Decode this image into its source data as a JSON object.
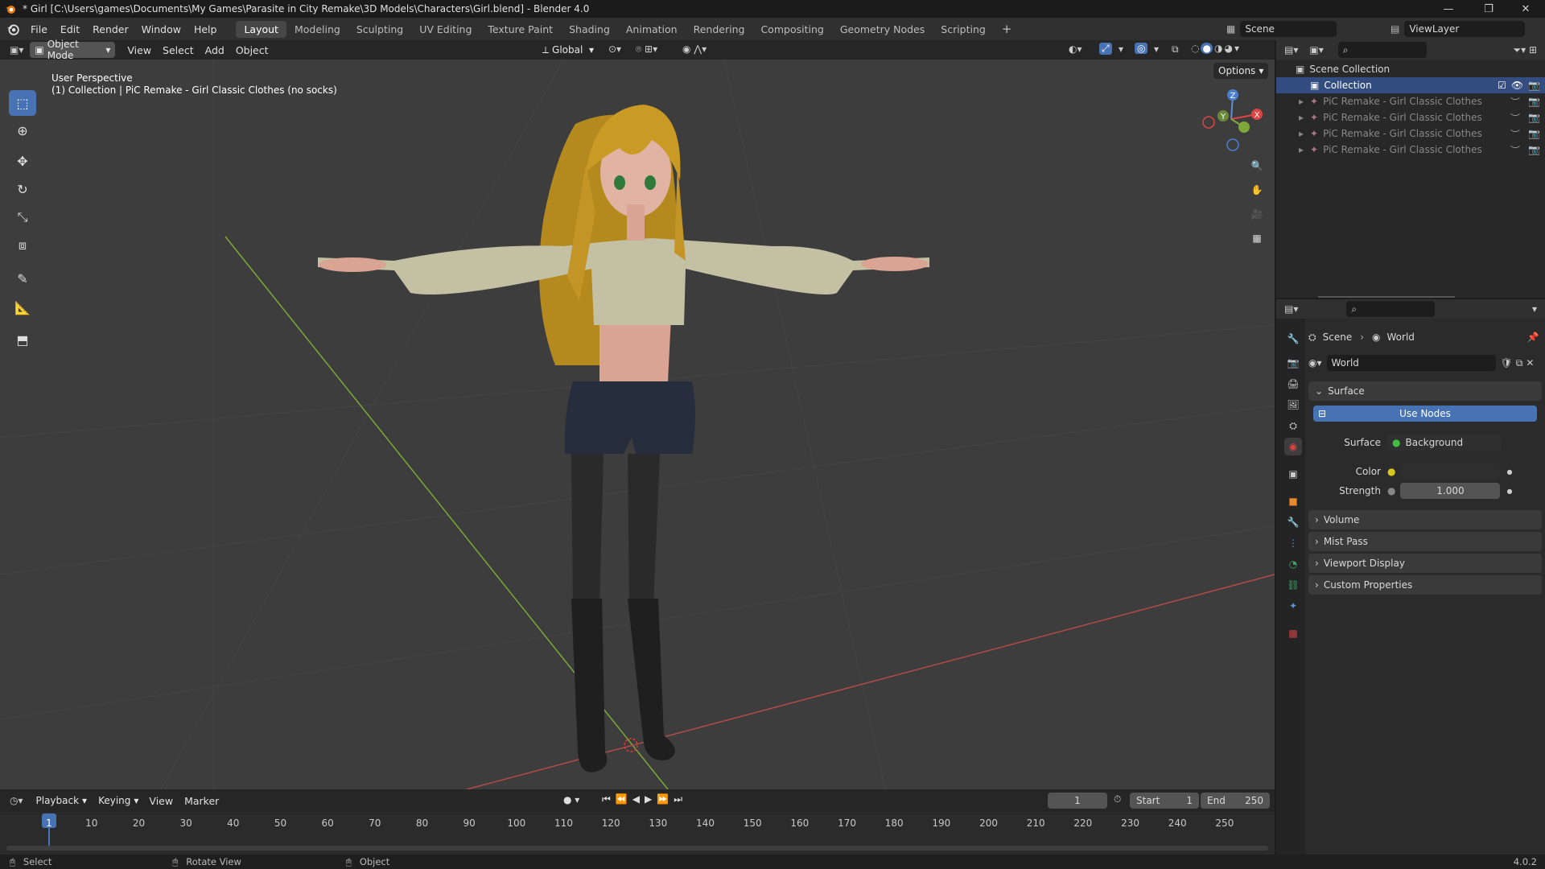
{
  "window": {
    "title": "* Girl [C:\\Users\\games\\Documents\\My Games\\Parasite in City Remake\\3D Models\\Characters\\Girl.blend] - Blender 4.0"
  },
  "menubar": {
    "menus": [
      "File",
      "Edit",
      "Render",
      "Window",
      "Help"
    ],
    "workspaces": [
      "Layout",
      "Modeling",
      "Sculpting",
      "UV Editing",
      "Texture Paint",
      "Shading",
      "Animation",
      "Rendering",
      "Compositing",
      "Geometry Nodes",
      "Scripting"
    ],
    "active_workspace": "Layout",
    "scene": "Scene",
    "viewlayer": "ViewLayer"
  },
  "viewport_header": {
    "mode": "Object Mode",
    "menus": [
      "View",
      "Select",
      "Add",
      "Object"
    ],
    "orientation": "Global",
    "options": "Options"
  },
  "viewport": {
    "perspective": "User Perspective",
    "info": "(1) Collection | PiC Remake - Girl Classic Clothes (no socks)",
    "gizmo": {
      "z": "Z",
      "y": "Y",
      "x": "X"
    }
  },
  "outliner": {
    "root": "Scene Collection",
    "collection": "Collection",
    "items": [
      "PiC Remake - Girl Classic Clothes (no",
      "PiC Remake - Girl Classic Clothes (soc",
      "PiC Remake - Girl Classic Clothes no t",
      "PiC Remake - Girl Classic Clothes no t"
    ]
  },
  "properties": {
    "breadcrumb": {
      "scene": "Scene",
      "world": "World"
    },
    "world_name": "World",
    "surface_panel": "Surface",
    "use_nodes": "Use Nodes",
    "surface_label": "Surface",
    "surface_value": "Background",
    "color_label": "Color",
    "strength_label": "Strength",
    "strength_value": "1.000",
    "panels": [
      "Volume",
      "Mist Pass",
      "Viewport Display",
      "Custom Properties"
    ]
  },
  "timeline": {
    "menus": [
      "Playback",
      "Keying",
      "View",
      "Marker"
    ],
    "current_frame": "1",
    "start_label": "Start",
    "start": "1",
    "end_label": "End",
    "end": "250",
    "ticks": [
      "1",
      "10",
      "20",
      "30",
      "40",
      "50",
      "60",
      "70",
      "80",
      "90",
      "100",
      "110",
      "120",
      "130",
      "140",
      "150",
      "160",
      "170",
      "180",
      "190",
      "200",
      "210",
      "220",
      "230",
      "240",
      "250"
    ]
  },
  "statusbar": {
    "select": "Select",
    "rotate": "Rotate View",
    "object": "Object",
    "version": "4.0.2"
  },
  "colors": {
    "accent": "#4772b3",
    "header": "#303030",
    "viewport": "#3d3d3d",
    "axis_x": "#b34a4a",
    "axis_y": "#7ea83a"
  }
}
